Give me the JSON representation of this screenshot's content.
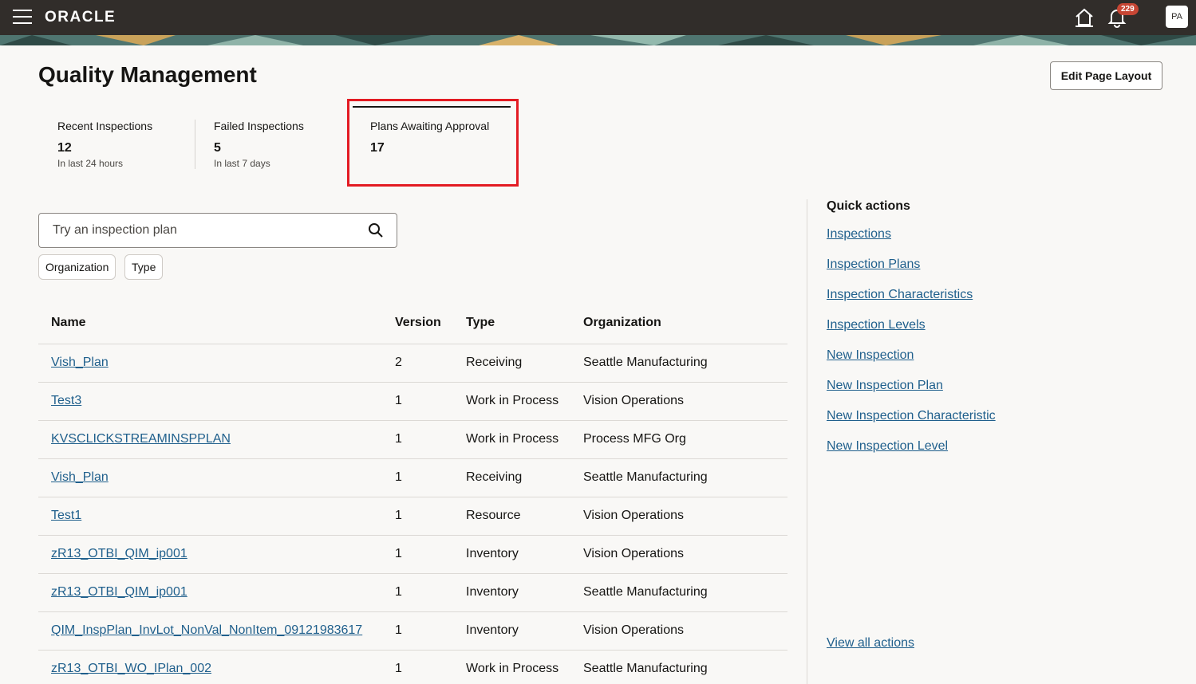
{
  "header": {
    "logo": "ORACLE",
    "notification_count": "229",
    "user_initials": "PA"
  },
  "page": {
    "title": "Quality Management",
    "edit_layout_label": "Edit Page Layout"
  },
  "metrics": [
    {
      "label": "Recent Inspections",
      "value": "12",
      "sub": "In last 24 hours"
    },
    {
      "label": "Failed Inspections",
      "value": "5",
      "sub": "In last 7 days"
    },
    {
      "label": "Plans Awaiting Approval",
      "value": "17",
      "sub": ""
    }
  ],
  "search": {
    "placeholder": "Try an inspection plan",
    "filters": [
      "Organization",
      "Type"
    ]
  },
  "table": {
    "columns": [
      "Name",
      "Version",
      "Type",
      "Organization"
    ],
    "rows": [
      {
        "name": "Vish_Plan",
        "version": "2",
        "type": "Receiving",
        "org": "Seattle Manufacturing"
      },
      {
        "name": "Test3",
        "version": "1",
        "type": "Work in Process",
        "org": "Vision Operations"
      },
      {
        "name": "KVSCLICKSTREAMINSPPLAN",
        "version": "1",
        "type": "Work in Process",
        "org": "Process MFG Org"
      },
      {
        "name": "Vish_Plan",
        "version": "1",
        "type": "Receiving",
        "org": "Seattle Manufacturing"
      },
      {
        "name": "Test1",
        "version": "1",
        "type": "Resource",
        "org": "Vision Operations"
      },
      {
        "name": "zR13_OTBI_QIM_ip001",
        "version": "1",
        "type": "Inventory",
        "org": "Vision Operations"
      },
      {
        "name": "zR13_OTBI_QIM_ip001",
        "version": "1",
        "type": "Inventory",
        "org": "Seattle Manufacturing"
      },
      {
        "name": "QIM_InspPlan_InvLot_NonVal_NonItem_09121983617",
        "version": "1",
        "type": "Inventory",
        "org": "Vision Operations"
      },
      {
        "name": "zR13_OTBI_WO_IPlan_002",
        "version": "1",
        "type": "Work in Process",
        "org": "Seattle Manufacturing"
      }
    ]
  },
  "quick_actions": {
    "title": "Quick actions",
    "links": [
      "Inspections",
      "Inspection Plans",
      "Inspection Characteristics",
      "Inspection Levels",
      "New Inspection",
      "New Inspection Plan",
      "New Inspection Characteristic",
      "New Inspection Level"
    ],
    "view_all": "View all actions"
  },
  "colors": {
    "header_bg": "#312d2a",
    "link": "#1f5f8c",
    "highlight": "#e31b23",
    "badge": "#c74634"
  }
}
